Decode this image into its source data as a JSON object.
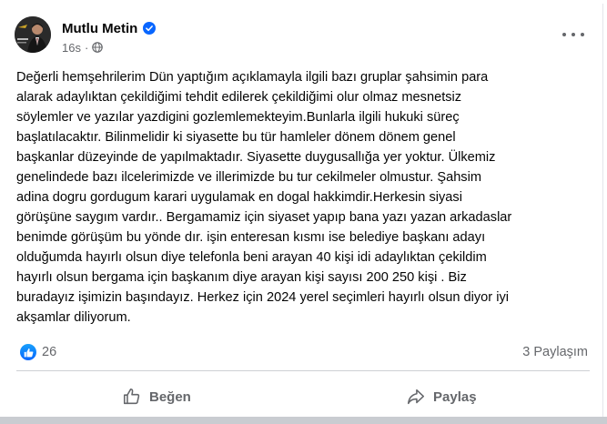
{
  "post": {
    "author": "Mutlu Metin",
    "timestamp": "16s",
    "audience_icon": "globe-icon",
    "text": "Değerli hemşehrilerim Dün yaptığım açıklamayla ilgili bazı gruplar şahsimin para\nalarak adaylıktan çekildiğimi tehdit edilerek çekildiğimi olur olmaz mesnetsiz\nsöylemler ve yazılar yazdigini gozlemlemekteyim.Bunlarla ilgili hukuki süreç\nbaşlatılacaktır.  Bilinmelidir ki siyasette bu tür hamleler dönem dönem genel\nbaşkanlar düzeyinde de yapılmaktadır. Siyasette duygusallığa yer yoktur. Ülkemiz\ngenelindede bazı ilcelerimizde ve illerimizde bu tur cekilmeler olmustur. Şahsim\nadina dogru gordugum karari uygulamak en dogal hakkimdir.Herkesin siyasi\ngörüşüne saygım vardır.. Bergamamiz için siyaset yapıp bana yazı yazan arkadaslar\nbenimde görüşüm bu yönde dır. işin enteresan kısmı ise belediye  başkanı adayı\nolduğumda hayırlı olsun diye  telefonla beni arayan 40 kişi idi adaylıktan çekildim\nhayırlı olsun bergama için başkanım  diye arayan kişi sayısı 200 250 kişi . Biz\nburadayız işimizin başındayız.  Herkez için 2024 yerel seçimleri hayırlı olsun diyor iyi\nakşamlar diliyorum."
  },
  "stats": {
    "like_count": "26",
    "share_count": "3 Paylaşım"
  },
  "actions": {
    "like_label": "Beğen",
    "share_label": "Paylaş"
  },
  "colors": {
    "accent": "#0866ff",
    "secondary_text": "#65676b"
  }
}
